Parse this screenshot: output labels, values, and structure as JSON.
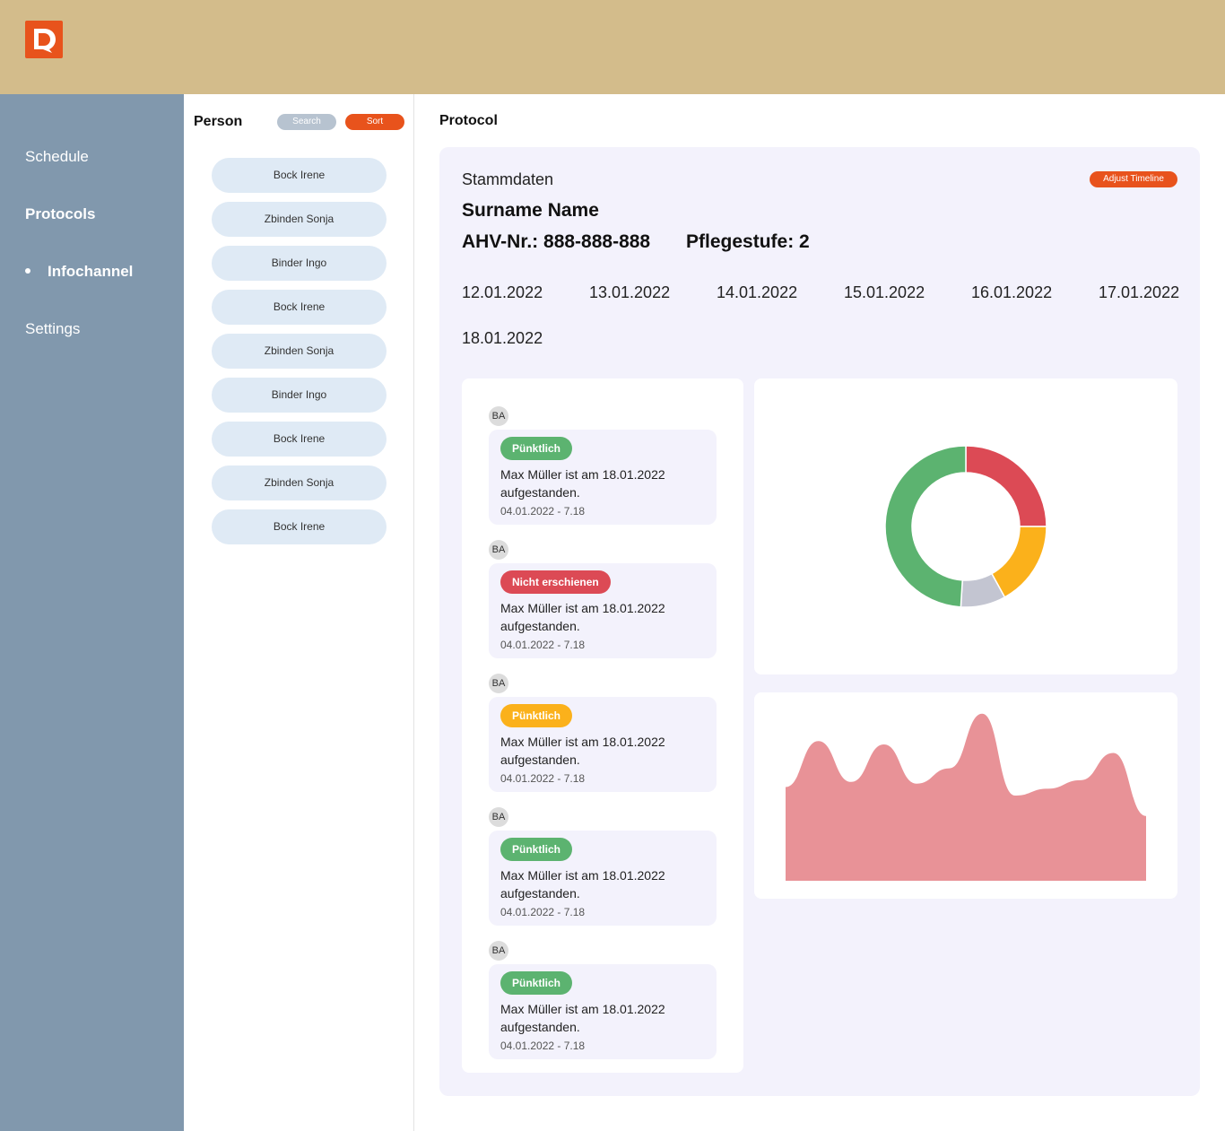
{
  "app": {
    "logo_icon": "document-logo-icon",
    "brand_color": "#e8531c"
  },
  "sidebar": {
    "items": [
      {
        "label": "Schedule"
      },
      {
        "label": "Protocols"
      },
      {
        "label": "Infochannel"
      },
      {
        "label": "Settings"
      }
    ]
  },
  "person_panel": {
    "title": "Person",
    "search_label": "Search",
    "sort_label": "Sort",
    "people": [
      "Bock Irene",
      "Zbinden Sonja",
      "Binder Ingo",
      "Bock Irene",
      "Zbinden Sonja",
      "Binder Ingo",
      "Bock Irene",
      "Zbinden Sonja",
      "Bock Irene"
    ]
  },
  "main": {
    "title": "Protocol",
    "section": "Stammdaten",
    "adjust_label": "Adjust Timeline",
    "surname": "Surname Name",
    "ahv": "AHV-Nr.: 888-888-888",
    "pflege": "Pflegestufe: 2",
    "dates": [
      "12.01.2022",
      "13.01.2022",
      "14.01.2022",
      "15.01.2022",
      "16.01.2022",
      "17.01.2022",
      "18.01.2022"
    ]
  },
  "feed": [
    {
      "avatar": "BA",
      "status": "Pünktlich",
      "status_color": "#5cb370",
      "text": "Max Müller ist am 18.01.2022 aufgestanden.",
      "date": "04.01.2022 - 7.18"
    },
    {
      "avatar": "BA",
      "status": "Nicht erschienen",
      "status_color": "#dc4a55",
      "text": "Max Müller ist am 18.01.2022 aufgestanden.",
      "date": "04.01.2022 - 7.18"
    },
    {
      "avatar": "BA",
      "status": "Pünktlich",
      "status_color": "#fbb11b",
      "text": "Max Müller ist am 18.01.2022 aufgestanden.",
      "date": "04.01.2022 - 7.18"
    },
    {
      "avatar": "BA",
      "status": "Pünktlich",
      "status_color": "#5cb370",
      "text": "Max Müller ist am 18.01.2022 aufgestanden.",
      "date": "04.01.2022 - 7.18"
    },
    {
      "avatar": "BA",
      "status": "Pünktlich",
      "status_color": "#5cb370",
      "text": "Max Müller ist am 18.01.2022 aufgestanden.",
      "date": "04.01.2022 - 7.18"
    }
  ],
  "chart_data": [
    {
      "type": "pie",
      "title": "",
      "slices": [
        {
          "value": 25,
          "color": "#dc4a55"
        },
        {
          "value": 17,
          "color": "#fbb11b"
        },
        {
          "value": 9,
          "color": "#c3c5d1"
        },
        {
          "value": 49,
          "color": "#5cb370"
        }
      ]
    },
    {
      "type": "area",
      "title": "",
      "x": [
        0,
        1,
        2,
        3,
        4,
        5,
        6,
        7,
        8,
        9,
        10,
        11
      ],
      "values": [
        55,
        82,
        58,
        80,
        57,
        66,
        98,
        50,
        54,
        59,
        75,
        38
      ],
      "color": "#e89297",
      "ylim": [
        0,
        100
      ]
    }
  ]
}
